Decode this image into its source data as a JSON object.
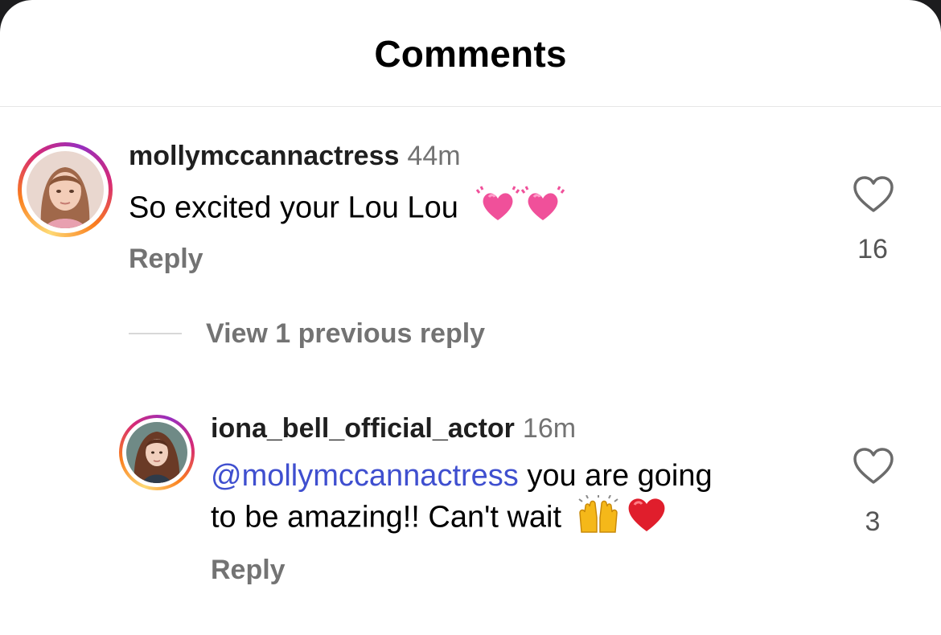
{
  "header": {
    "title": "Comments"
  },
  "comments": [
    {
      "username": "mollymccannactress",
      "time": "44m",
      "text": "So excited your Lou Lou",
      "emojis": [
        "beating-heart-emoji",
        "beating-heart-emoji"
      ],
      "reply_label": "Reply",
      "likes": "16"
    }
  ],
  "view_replies": {
    "label": "View 1 previous reply"
  },
  "replies": [
    {
      "username": "iona_bell_official_actor",
      "time": "16m",
      "mention": "@mollymccannactress",
      "text_line1": " you are going",
      "text_line2": "to be amazing!! Can't wait",
      "emojis": [
        "raising-hands-emoji",
        "red-heart-emoji"
      ],
      "reply_label": "Reply",
      "likes": "3"
    }
  ],
  "colors": {
    "mention": "#3f4fcf",
    "secondary_text": "#737373",
    "ring_gradient": [
      "#feda75",
      "#fa7e1e",
      "#d62976",
      "#962fbf"
    ]
  }
}
